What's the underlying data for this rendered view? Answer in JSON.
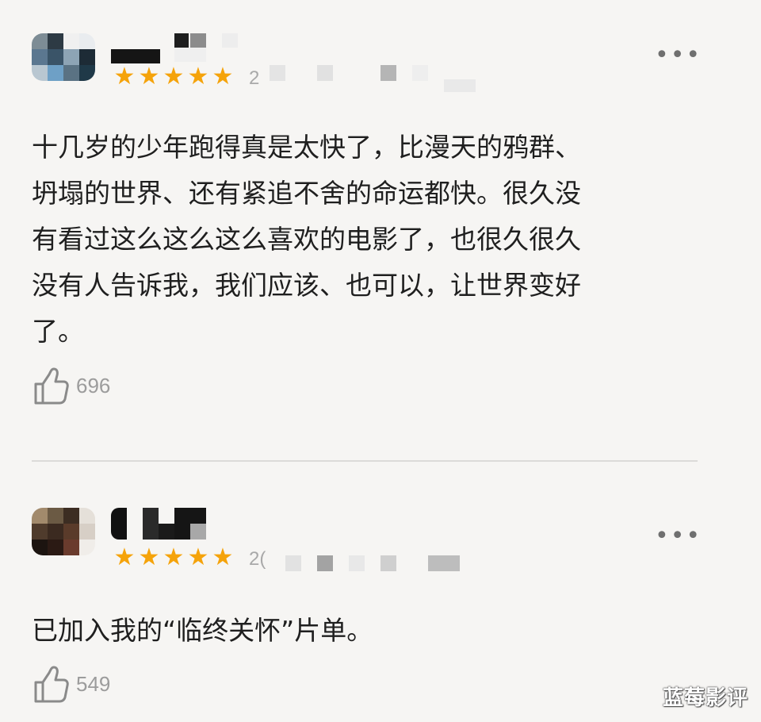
{
  "reviews": [
    {
      "date_prefix": "2",
      "stars": [
        "★",
        "★",
        "★",
        "★",
        "★"
      ],
      "more": "•••",
      "text": "十几岁的少年跑得真是太快了，比漫天的鸦群、\n坍塌的世界、还有紧追不舍的命运都快。很久没\n有看过这么这么这么喜欢的电影了，也很久很久\n没有人告诉我，我们应该、也可以，让世界变好\n了。",
      "likes": "696",
      "rating": 5,
      "accent_color": "#f5a30a"
    },
    {
      "date_prefix": "2(",
      "stars": [
        "★",
        "★",
        "★",
        "★",
        "★"
      ],
      "more": "•••",
      "text": "已加入我的“临终关怀”片单。",
      "likes": "549",
      "rating": 5,
      "accent_color": "#f5a30a"
    }
  ],
  "icons": {
    "more": "more-horizontal-icon",
    "like": "thumbs-up-icon"
  },
  "watermark": "蓝莓影评"
}
